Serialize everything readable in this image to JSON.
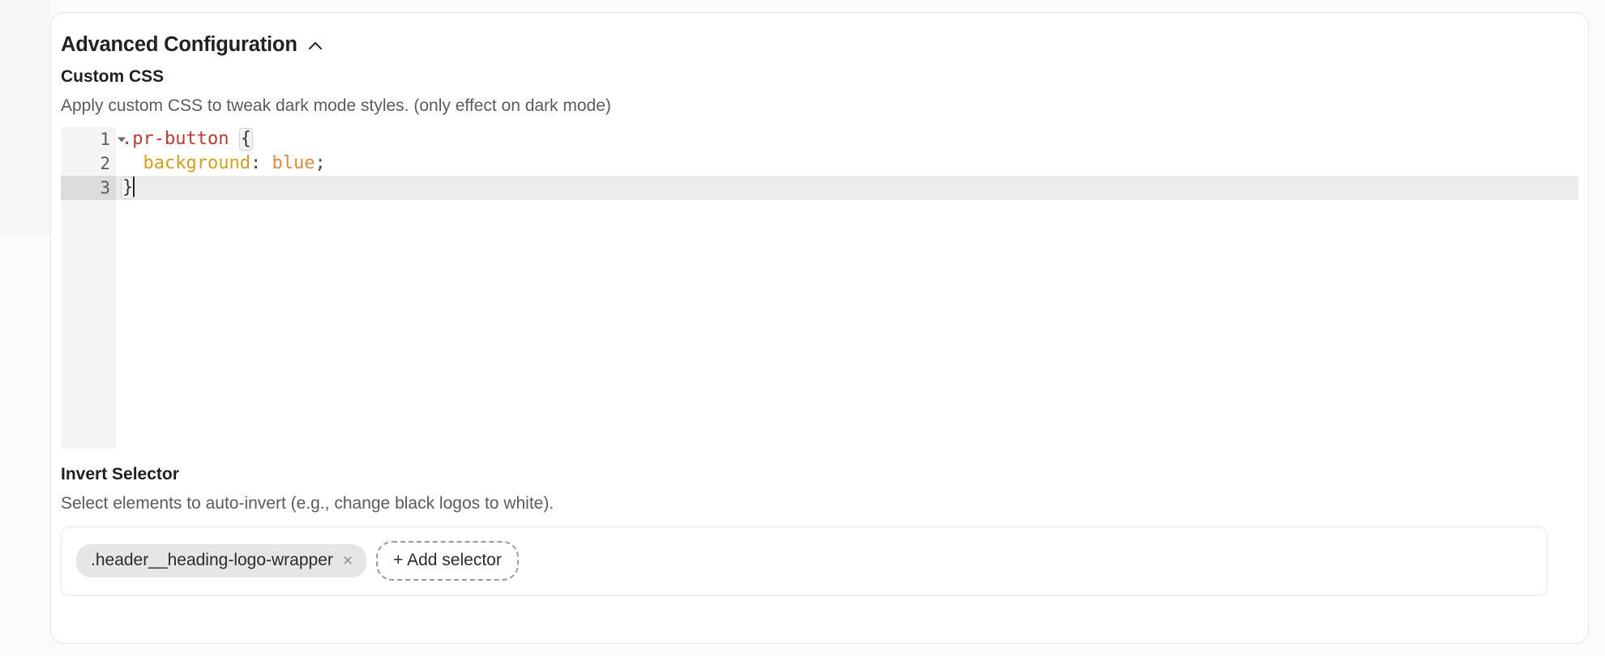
{
  "section": {
    "title": "Advanced Configuration",
    "collapse_icon": "chevron-up-icon"
  },
  "custom_css": {
    "label": "Custom CSS",
    "help": "Apply custom CSS to tweak dark mode styles. (only effect on dark mode)",
    "editor": {
      "language": "css",
      "active_line": 3,
      "gutter": [
        {
          "number": "1",
          "has_fold_arrow": true
        },
        {
          "number": "2",
          "has_fold_arrow": false
        },
        {
          "number": "3",
          "has_fold_arrow": false
        }
      ],
      "lines": [
        {
          "selector": ".pr-button",
          "space": " ",
          "brace": "{"
        },
        {
          "indent": "  ",
          "property": "background",
          "colon": ": ",
          "value": "blue",
          "semicolon": ";"
        },
        {
          "brace": "}"
        }
      ],
      "full_text": ".pr-button {\n  background: blue;\n}",
      "colors": {
        "selector": "#c0392b",
        "property": "#d4a017",
        "value": "#e8883a",
        "punctuation": "#444444",
        "gutter_bg": "#f5f5f5",
        "active_line_bg": "#ececec",
        "active_gutter_bg": "#dcdcdc"
      }
    }
  },
  "invert_selector": {
    "label": "Invert Selector",
    "help": "Select elements to auto-invert (e.g., change black logos to white).",
    "chips": [
      {
        "text": ".header__heading-logo-wrapper",
        "remove_icon": "close-icon",
        "remove_glyph": "×"
      }
    ],
    "add_button": {
      "label": "+ Add selector"
    }
  }
}
